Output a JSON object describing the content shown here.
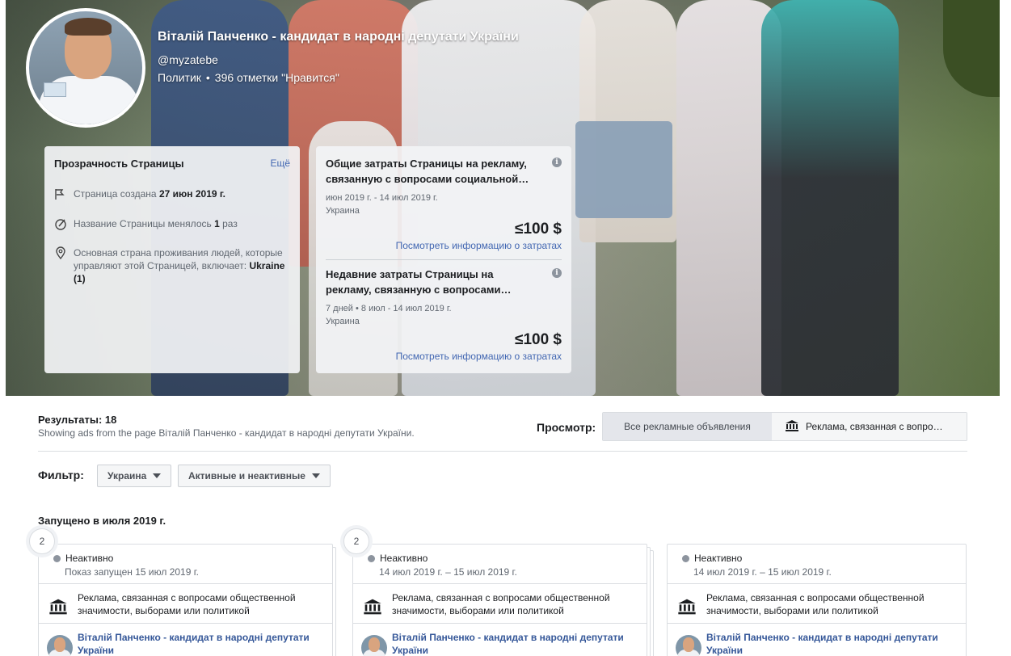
{
  "page": {
    "title": "Віталій Панченко - кандидат в народні депутати України",
    "handle": "@myzatebe",
    "category": "Политик",
    "likes": "396 отметки \"Нравится\""
  },
  "transparency": {
    "title": "Прозрачность Страницы",
    "more": "Ещё",
    "created_label": "Страница создана ",
    "created_date": "27 июн 2019 г.",
    "name_changed_label": "Название Страницы менялось ",
    "name_changed_count": "1",
    "name_changed_suffix": " раз",
    "country_label": "Основная страна проживания людей, которые управляют этой Страницей, включает: ",
    "country_value": "Ukraine (1)"
  },
  "spend": {
    "total": {
      "title": "Общие затраты Страницы на рекламу,\nсвязанную с вопросами социальной…",
      "period": "июн 2019 г. - 14 июл 2019 г.",
      "region": "Украина",
      "amount": "≤100 $",
      "link": "Посмотреть информацию о затратах"
    },
    "recent": {
      "title": "Недавние затраты Страницы на\nрекламу, связанную с вопросами…",
      "period": "7 дней • 8 июл - 14 июл 2019 г.",
      "region": "Украина",
      "amount": "≤100 $",
      "link": "Посмотреть информацию о затратах"
    }
  },
  "results": {
    "label": "Результаты: 18",
    "sub": "Showing ads from the page Віталій Панченко - кандидат в народні депутати України.",
    "view_label": "Просмотр:",
    "view_all": "Все рекламные объявления",
    "view_political": "Реклама, связанная с вопро…"
  },
  "filter": {
    "label": "Фильтр:",
    "country": "Украина",
    "status": "Активные и неактивные"
  },
  "section_title": "Запущено в июля 2019 г.",
  "ads": [
    {
      "count": "2",
      "status": "Неактивно",
      "date": "Показ запущен 15 июл 2019 г.",
      "category": "Реклама, связанная с вопросами общественной значимости, выборами или политикой",
      "advertiser": "Віталій Панченко - кандидат в народні депутати України"
    },
    {
      "count": "2",
      "status": "Неактивно",
      "date": "14 июл 2019 г. – 15 июл 2019 г.",
      "category": "Реклама, связанная с вопросами общественной значимости, выборами или политикой",
      "advertiser": "Віталій Панченко - кандидат в народні депутати України"
    },
    {
      "count": "",
      "status": "Неактивно",
      "date": "14 июл 2019 г. – 15 июл 2019 г.",
      "category": "Реклама, связанная с вопросами общественной значимости, выборами или политикой",
      "advertiser": "Віталій Панченко - кандидат в народні депутати України"
    }
  ],
  "colors": {
    "link": "#4267b2",
    "advertiser_link": "#365899",
    "inactive_dot": "#8d949e"
  }
}
